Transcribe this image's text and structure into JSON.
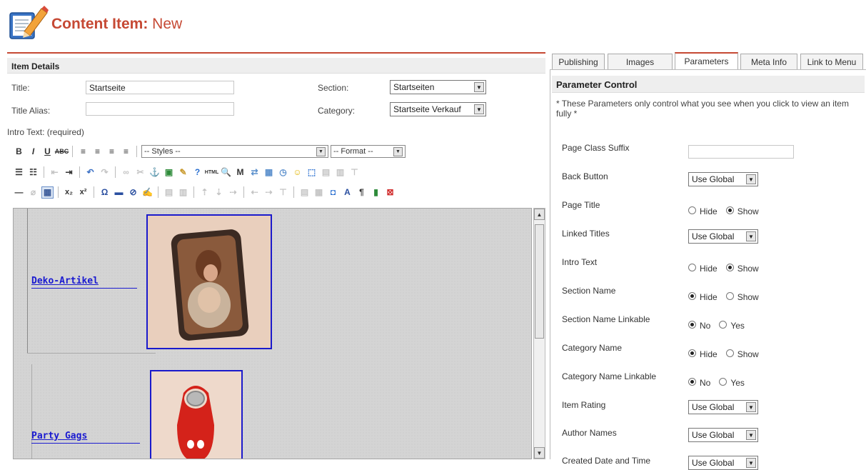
{
  "header": {
    "title": "Content Item:",
    "title_suffix": "New",
    "icon": "edit-document-icon"
  },
  "item_details": {
    "heading": "Item Details",
    "title_label": "Title:",
    "title_value": "Startseite",
    "alias_label": "Title Alias:",
    "alias_value": "",
    "section_label": "Section:",
    "section_value": "Startseiten",
    "category_label": "Category:",
    "category_value": "Startseite Verkauf",
    "intro_label": "Intro Text: (required)"
  },
  "editor": {
    "styles_value": "-- Styles --",
    "format_value": "-- Format --",
    "products": [
      {
        "label": "Deko-Artikel"
      },
      {
        "label": "Party Gags"
      }
    ]
  },
  "tabs": [
    {
      "label": "Publishing",
      "active": false
    },
    {
      "label": "Images",
      "active": false
    },
    {
      "label": "Parameters",
      "active": true
    },
    {
      "label": "Meta Info",
      "active": false
    },
    {
      "label": "Link to Menu",
      "active": false
    }
  ],
  "parameters": {
    "heading": "Parameter Control",
    "note": "* These Parameters only control what you see when you click to view an item fully *",
    "rows": [
      {
        "label": "Page Class Suffix",
        "type": "text",
        "value": ""
      },
      {
        "label": "Back Button",
        "type": "select",
        "value": "Use Global"
      },
      {
        "label": "Page Title",
        "type": "radio",
        "options": [
          "Hide",
          "Show"
        ],
        "selected": "Show"
      },
      {
        "label": "Linked Titles",
        "type": "select",
        "value": "Use Global"
      },
      {
        "label": "Intro Text",
        "type": "radio",
        "options": [
          "Hide",
          "Show"
        ],
        "selected": "Show"
      },
      {
        "label": "Section Name",
        "type": "radio",
        "options": [
          "Hide",
          "Show"
        ],
        "selected": "Hide"
      },
      {
        "label": "Section Name Linkable",
        "type": "radio",
        "options": [
          "No",
          "Yes"
        ],
        "selected": "No"
      },
      {
        "label": "Category Name",
        "type": "radio",
        "options": [
          "Hide",
          "Show"
        ],
        "selected": "Hide"
      },
      {
        "label": "Category Name Linkable",
        "type": "radio",
        "options": [
          "No",
          "Yes"
        ],
        "selected": "No"
      },
      {
        "label": "Item Rating",
        "type": "select",
        "value": "Use Global"
      },
      {
        "label": "Author Names",
        "type": "select",
        "value": "Use Global"
      },
      {
        "label": "Created Date and Time",
        "type": "select",
        "value": "Use Global"
      }
    ]
  },
  "colors": {
    "accent": "#c64934",
    "link": "#1a1ad0",
    "image_border": "#1a1acc"
  }
}
